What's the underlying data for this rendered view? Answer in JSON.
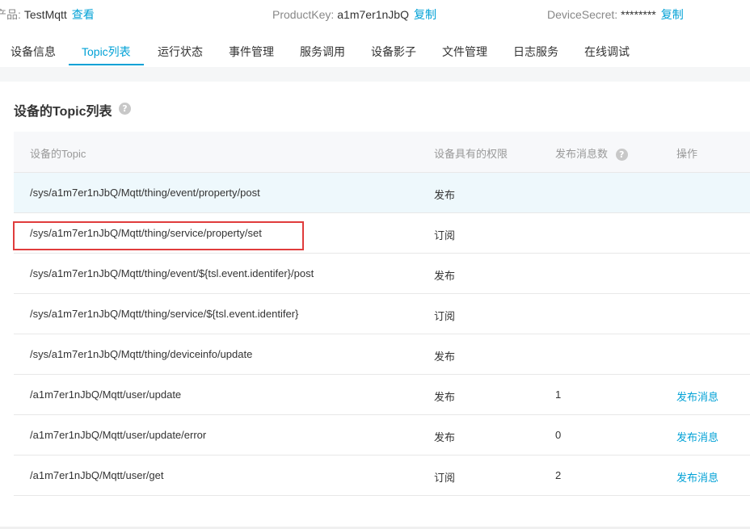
{
  "info": {
    "product_label": "产品:",
    "product_value": "TestMqtt",
    "product_link": "查看",
    "productkey_label": "ProductKey:",
    "productkey_value": "a1m7er1nJbQ",
    "productkey_link": "复制",
    "secret_label": "DeviceSecret:",
    "secret_value": "********",
    "secret_link": "复制"
  },
  "tabs": [
    {
      "label": "设备信息"
    },
    {
      "label": "Topic列表"
    },
    {
      "label": "运行状态"
    },
    {
      "label": "事件管理"
    },
    {
      "label": "服务调用"
    },
    {
      "label": "设备影子"
    },
    {
      "label": "文件管理"
    },
    {
      "label": "日志服务"
    },
    {
      "label": "在线调试"
    }
  ],
  "active_tab": "Topic列表",
  "section": {
    "title": "设备的Topic列表",
    "help": "?"
  },
  "table": {
    "headers": {
      "topic": "设备的Topic",
      "permission": "设备具有的权限",
      "count": "发布消息数",
      "count_help": "?",
      "action": "操作"
    },
    "rows": [
      {
        "topic": "/sys/a1m7er1nJbQ/Mqtt/thing/event/property/post",
        "permission": "发布",
        "count": "",
        "action": ""
      },
      {
        "topic": "/sys/a1m7er1nJbQ/Mqtt/thing/service/property/set",
        "permission": "订阅",
        "count": "",
        "action": ""
      },
      {
        "topic": "/sys/a1m7er1nJbQ/Mqtt/thing/event/${tsl.event.identifer}/post",
        "permission": "发布",
        "count": "",
        "action": ""
      },
      {
        "topic": "/sys/a1m7er1nJbQ/Mqtt/thing/service/${tsl.event.identifer}",
        "permission": "订阅",
        "count": "",
        "action": ""
      },
      {
        "topic": "/sys/a1m7er1nJbQ/Mqtt/thing/deviceinfo/update",
        "permission": "发布",
        "count": "",
        "action": ""
      },
      {
        "topic": "/a1m7er1nJbQ/Mqtt/user/update",
        "permission": "发布",
        "count": "1",
        "action": "发布消息"
      },
      {
        "topic": "/a1m7er1nJbQ/Mqtt/user/update/error",
        "permission": "发布",
        "count": "0",
        "action": "发布消息"
      },
      {
        "topic": "/a1m7er1nJbQ/Mqtt/user/get",
        "permission": "订阅",
        "count": "2",
        "action": "发布消息"
      }
    ]
  },
  "colors": {
    "accent": "#00a1d6",
    "highlight": "#e03c3c",
    "hover_row": "#eef8fc"
  }
}
